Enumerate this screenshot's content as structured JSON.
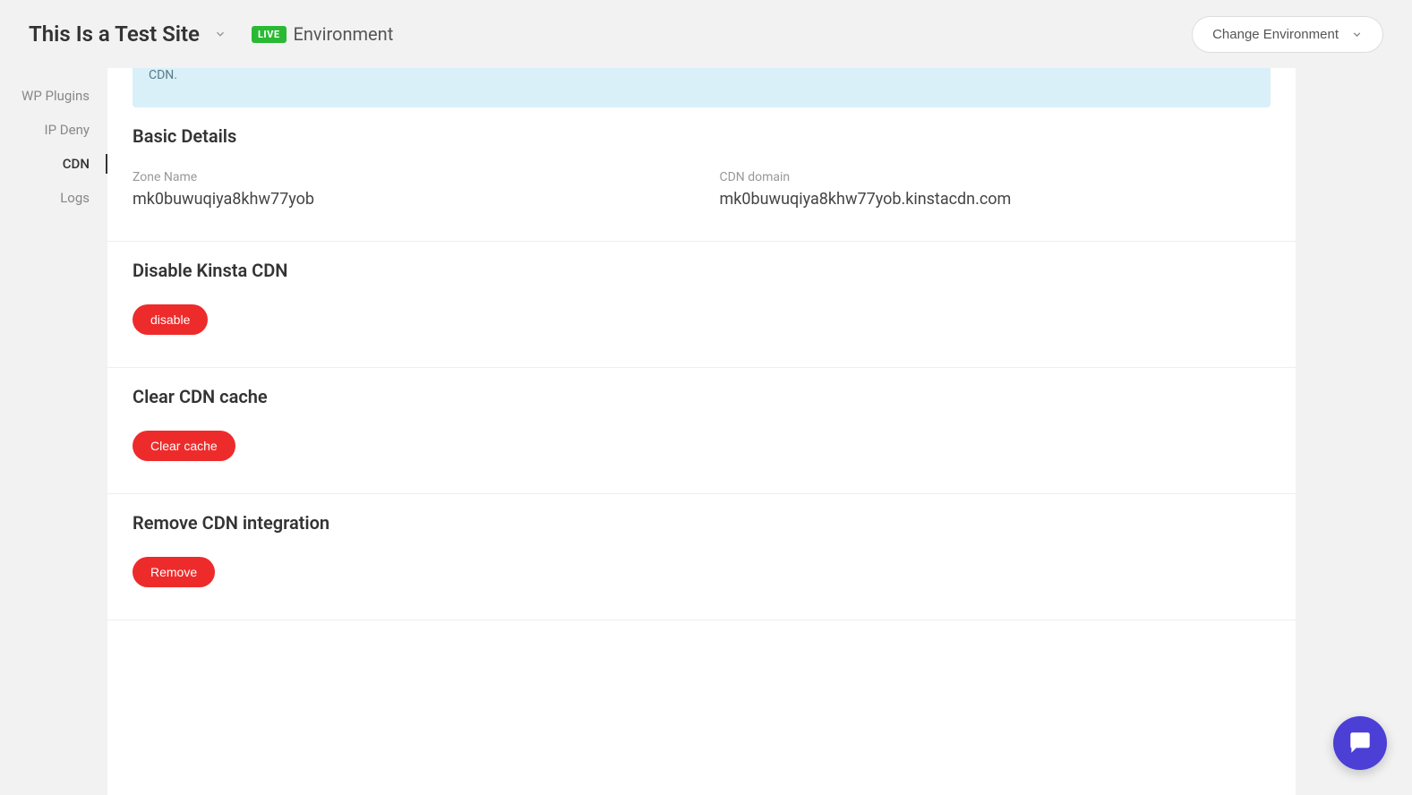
{
  "header": {
    "site_title": "This Is a Test Site",
    "live_badge": "LIVE",
    "environment_label": "Environment",
    "change_environment": "Change Environment"
  },
  "sidebar": {
    "items": [
      {
        "label": "WP Plugins",
        "active": false
      },
      {
        "label": "IP Deny",
        "active": false
      },
      {
        "label": "CDN",
        "active": true
      },
      {
        "label": "Logs",
        "active": false
      }
    ]
  },
  "info_box": {
    "text": "CDN."
  },
  "basic_details": {
    "title": "Basic Details",
    "zone_name_label": "Zone Name",
    "zone_name_value": "mk0buwuqiya8khw77yob",
    "cdn_domain_label": "CDN domain",
    "cdn_domain_value": "mk0buwuqiya8khw77yob.kinstacdn.com"
  },
  "disable_cdn": {
    "title": "Disable Kinsta CDN",
    "button": "disable"
  },
  "clear_cache": {
    "title": "Clear CDN cache",
    "button": "Clear cache"
  },
  "remove_integration": {
    "title": "Remove CDN integration",
    "button": "Remove"
  }
}
